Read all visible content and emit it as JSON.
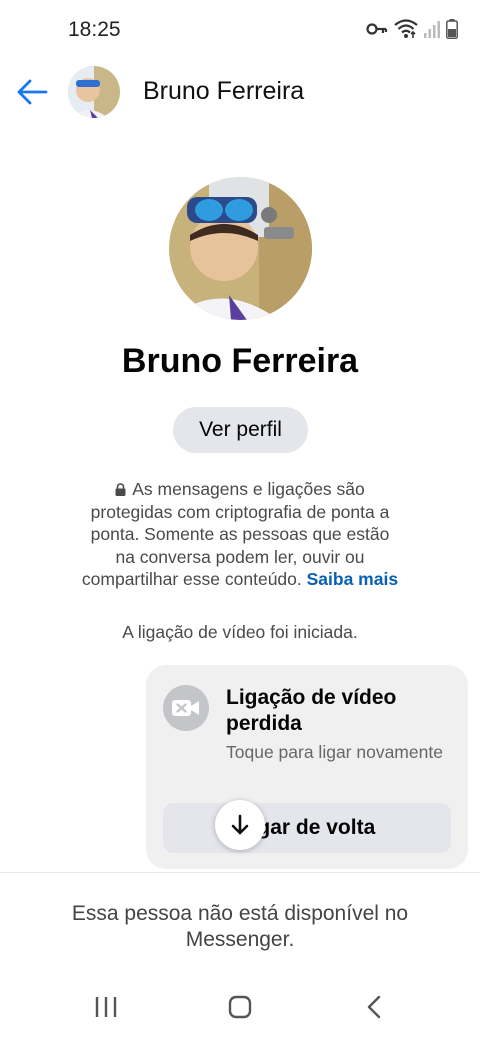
{
  "status_bar": {
    "time": "18:25",
    "icons": [
      "vpn-key-icon",
      "wifi-icon",
      "signal-icon",
      "battery-icon"
    ]
  },
  "header": {
    "back_icon": "arrow-left-icon",
    "contact_name": "Bruno Ferreira"
  },
  "profile": {
    "name": "Bruno Ferreira",
    "view_profile_label": "Ver perfil"
  },
  "e2ee_notice": {
    "text": "As mensagens e ligações são protegidas com criptografia de ponta a ponta. Somente as pessoas que estão na conversa podem ler, ouvir ou compartilhar esse conteúdo.",
    "learn_more": "Saiba mais"
  },
  "conversation": {
    "event_text": "A ligação de vídeo foi iniciada.",
    "missed_call": {
      "title": "Ligação de vídeo perdida",
      "subtitle": "Toque para ligar novamente",
      "call_back_label": "Ligar de volta"
    }
  },
  "footer": {
    "unavailable_text": "Essa pessoa não está disponível no Messenger."
  },
  "nav_bar": {
    "buttons": [
      "recent-apps-icon",
      "home-icon",
      "back-icon"
    ]
  },
  "colors": {
    "accent": "#1877f2",
    "link": "#0a5fb5",
    "bubble": "#f0f0f0",
    "button": "#e4e6eb"
  }
}
